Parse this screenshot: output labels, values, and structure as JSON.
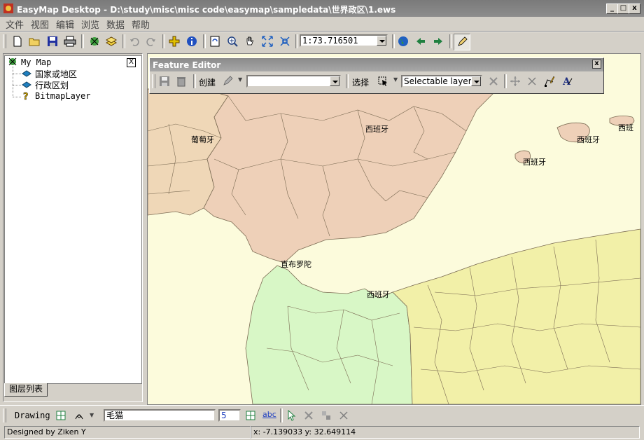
{
  "window": {
    "title": "EasyMap Desktop - D:\\study\\misc\\misc code\\easymap\\sampledata\\世界政区\\1.ews",
    "min_glyph": "_",
    "max_glyph": "□",
    "close_glyph": "x"
  },
  "menu": {
    "items": [
      "文件",
      "视图",
      "编辑",
      "浏览",
      "数据",
      "帮助"
    ]
  },
  "toolbar": {
    "scale_value": "1:73.716501"
  },
  "layers_panel": {
    "close_glyph": "X",
    "tab_label": "图层列表",
    "tree": [
      {
        "label": "My Map"
      },
      {
        "label": "国家或地区"
      },
      {
        "label": "行政区划"
      },
      {
        "label": "BitmapLayer"
      }
    ]
  },
  "feature_editor": {
    "title": "Feature Editor",
    "close_glyph": "x",
    "create_label": "创建",
    "target_value": "",
    "select_label": "选择",
    "layer_select_value": "Selectable layers"
  },
  "map": {
    "labels": [
      "葡萄牙",
      "西班牙",
      "西班牙",
      "西班牙",
      "西班",
      "直布罗陀",
      "西班牙"
    ]
  },
  "drawing_bar": {
    "drawing_label": "Drawing",
    "text_value": "毛猫",
    "size_value": "5",
    "abc_glyph": "abc"
  },
  "status": {
    "left": "Designed by Ziken Y",
    "coords": "x: -7.139033  y: 32.649114"
  },
  "colors": {
    "spain": "#eed0b8",
    "portugal": "#efd7b7",
    "morocco": "#d8f7c6",
    "algeria": "#f2f0a8",
    "sea": "#fcfbdc",
    "border": "#7a6a52"
  }
}
